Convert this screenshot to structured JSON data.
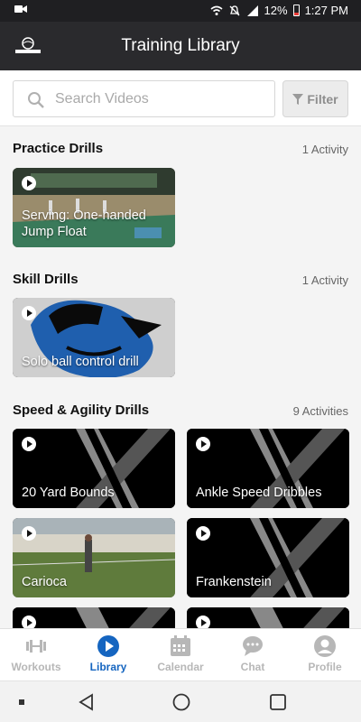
{
  "status_bar": {
    "time": "1:27 PM",
    "battery": "12%"
  },
  "header": {
    "title": "Training Library"
  },
  "search": {
    "placeholder": "Search Videos",
    "filter_label": "Filter"
  },
  "sections": [
    {
      "name": "Practice Drills",
      "count": "1 Activity",
      "items": [
        {
          "title": "Serving: One-handed Jump Float",
          "thumb": "gym"
        }
      ]
    },
    {
      "name": "Skill Drills",
      "count": "1 Activity",
      "items": [
        {
          "title": "Solo ball control drill",
          "thumb": "logo-blue"
        }
      ]
    },
    {
      "name": "Speed & Agility Drills",
      "count": "9 Activities",
      "items": [
        {
          "title": "20 Yard Bounds",
          "thumb": "x-logo"
        },
        {
          "title": "Ankle Speed Dribbles",
          "thumb": "x-logo"
        },
        {
          "title": "Carioca",
          "thumb": "field"
        },
        {
          "title": "Frankenstein",
          "thumb": "x-logo"
        }
      ]
    }
  ],
  "tabs": [
    {
      "label": "Workouts",
      "icon": "dumbbell-icon",
      "active": false
    },
    {
      "label": "Library",
      "icon": "play-circle-icon",
      "active": true
    },
    {
      "label": "Calendar",
      "icon": "calendar-icon",
      "active": false
    },
    {
      "label": "Chat",
      "icon": "chat-icon",
      "active": false
    },
    {
      "label": "Profile",
      "icon": "profile-icon",
      "active": false
    }
  ],
  "colors": {
    "accent": "#1565c0",
    "header_bg": "#2a2a2d",
    "inactive": "#b7b7b7"
  }
}
